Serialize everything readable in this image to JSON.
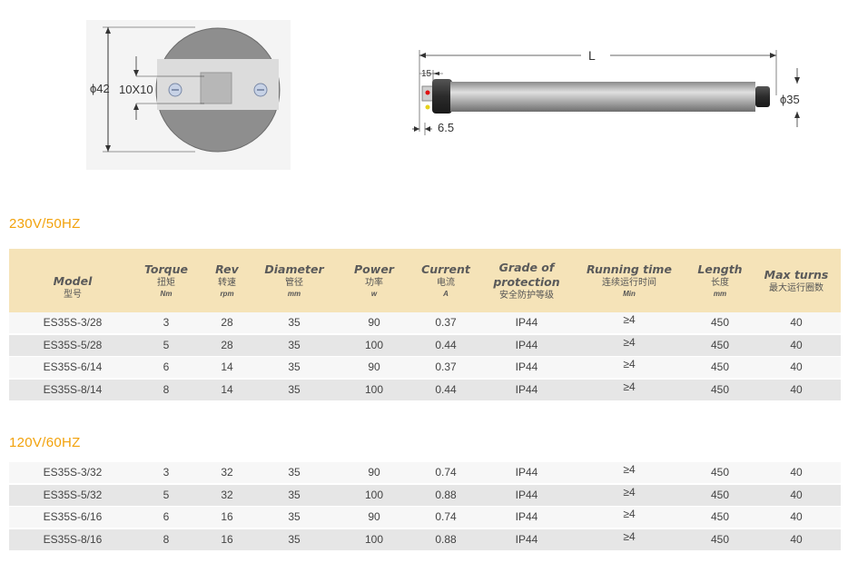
{
  "diagram_end": {
    "diameter": "ϕ42",
    "slot": "10X10"
  },
  "diagram_side": {
    "length": "L",
    "head": "15",
    "offset": "6.5",
    "diameter": "ϕ35"
  },
  "sections": [
    {
      "title": "230V/50HZ"
    },
    {
      "title": "120V/60HZ"
    }
  ],
  "columns": [
    {
      "en": "Model",
      "zh": "型号",
      "unit": ""
    },
    {
      "en": "Torque",
      "zh": "扭矩",
      "unit": "Nm"
    },
    {
      "en": "Rev",
      "zh": "转速",
      "unit": "rpm"
    },
    {
      "en": "Diameter",
      "zh": "管径",
      "unit": "mm"
    },
    {
      "en": "Power",
      "zh": "功率",
      "unit": "w"
    },
    {
      "en": "Current",
      "zh": "电流",
      "unit": "A"
    },
    {
      "en": "Grade of",
      "en2": "protection",
      "zh": "安全防护等级",
      "unit": ""
    },
    {
      "en": "Running time",
      "zh": "连续运行时间",
      "unit": "Min"
    },
    {
      "en": "Length",
      "zh": "长度",
      "unit": "mm"
    },
    {
      "en": "Max turns",
      "zh": "最大运行圈数",
      "unit": ""
    }
  ],
  "table1": [
    [
      "ES35S-3/28",
      "3",
      "28",
      "35",
      "90",
      "0.37",
      "IP44",
      "≥4",
      "450",
      "40"
    ],
    [
      "ES35S-5/28",
      "5",
      "28",
      "35",
      "100",
      "0.44",
      "IP44",
      "≥4",
      "450",
      "40"
    ],
    [
      "ES35S-6/14",
      "6",
      "14",
      "35",
      "90",
      "0.37",
      "IP44",
      "≥4",
      "450",
      "40"
    ],
    [
      "ES35S-8/14",
      "8",
      "14",
      "35",
      "100",
      "0.44",
      "IP44",
      "≥4",
      "450",
      "40"
    ]
  ],
  "table2": [
    [
      "ES35S-3/32",
      "3",
      "32",
      "35",
      "90",
      "0.74",
      "IP44",
      "≥4",
      "450",
      "40"
    ],
    [
      "ES35S-5/32",
      "5",
      "32",
      "35",
      "100",
      "0.88",
      "IP44",
      "≥4",
      "450",
      "40"
    ],
    [
      "ES35S-6/16",
      "6",
      "16",
      "35",
      "90",
      "0.74",
      "IP44",
      "≥4",
      "450",
      "40"
    ],
    [
      "ES35S-8/16",
      "8",
      "16",
      "35",
      "100",
      "0.88",
      "IP44",
      "≥4",
      "450",
      "40"
    ]
  ]
}
